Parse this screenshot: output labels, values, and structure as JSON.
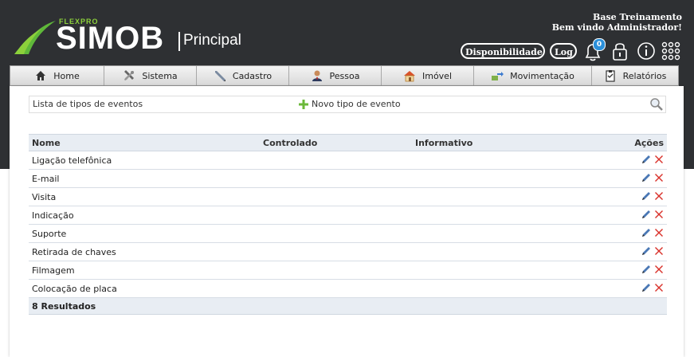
{
  "header": {
    "brand_small": "FLEXPRO",
    "brand": "SIMOB",
    "module": "Principal",
    "org": "Base Treinamento",
    "greeting": "Bem vindo Administrador!",
    "availability_label": "Disponibilidade",
    "log_label": "Log",
    "notification_count": "0"
  },
  "nav": {
    "items": [
      {
        "label": "Home",
        "icon": "home-icon"
      },
      {
        "label": "Sistema",
        "icon": "tools-icon"
      },
      {
        "label": "Cadastro",
        "icon": "pen-icon"
      },
      {
        "label": "Pessoa",
        "icon": "person-icon"
      },
      {
        "label": "Imóvel",
        "icon": "house-icon"
      },
      {
        "label": "Movimentação",
        "icon": "transfer-icon"
      },
      {
        "label": "Relatórios",
        "icon": "clipboard-icon"
      }
    ]
  },
  "toolbar": {
    "title": "Lista de tipos de eventos",
    "new_label": "Novo tipo de evento"
  },
  "table": {
    "columns": [
      "Nome",
      "Controlado",
      "Informativo",
      "Ações"
    ],
    "rows": [
      "Ligação telefônica",
      "E-mail",
      "Visita",
      "Indicação",
      "Suporte",
      "Retirada de chaves",
      "Filmagem",
      "Colocação de placa"
    ],
    "results": "8 Resultados"
  },
  "colors": {
    "header_bg": "#2e3033",
    "brand_green": "#8cd13b",
    "edit_blue": "#4a78b5",
    "delete_red": "#d9312b"
  }
}
